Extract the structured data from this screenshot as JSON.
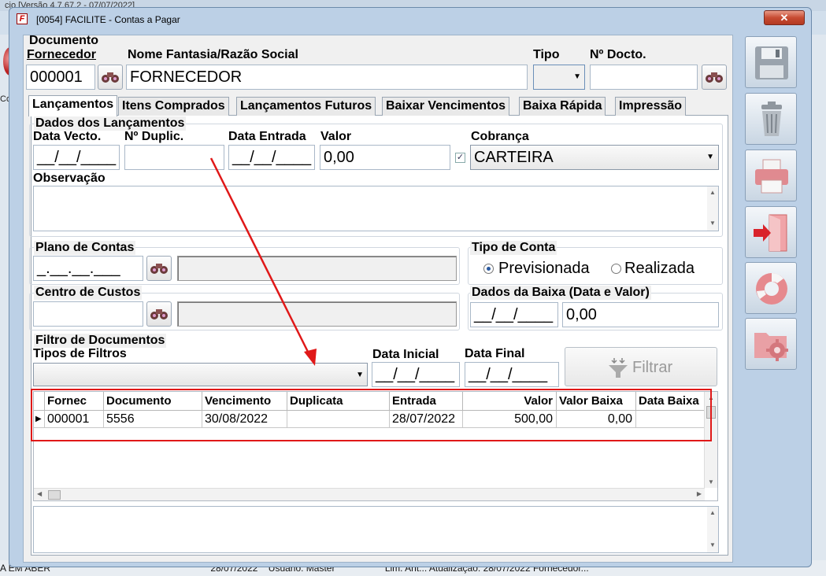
{
  "background_app": {
    "title": "cio [Versão 4.7.67.2 - 07/07/2022]",
    "side_text": "Co",
    "status_left": "A EM ABER",
    "status_texts": [
      "28/07/2022",
      "Usuário: Master",
      "Lim. Ant... Atualização: 28/07/2022 Fornecedor..."
    ]
  },
  "window": {
    "title": "[0054] FACILITE - Contas a Pagar",
    "close_label": "✕"
  },
  "header": {
    "documento_label": "Documento",
    "fornecedor_label": "Fornecedor",
    "fornecedor_value": "000001",
    "nome_label": "Nome Fantasia/Razão Social",
    "nome_value": "FORNECEDOR",
    "tipo_label": "Tipo",
    "tipo_value": "",
    "docto_label": "Nº Docto.",
    "docto_value": ""
  },
  "tabs": [
    {
      "label": "Lançamentos",
      "active": true
    },
    {
      "label": "Itens Comprados",
      "active": false
    },
    {
      "label": "Lançamentos Futuros",
      "active": false
    },
    {
      "label": "Baixar Vencimentos",
      "active": false
    },
    {
      "label": "Baixa Rápida",
      "active": false
    },
    {
      "label": "Impressão",
      "active": false
    }
  ],
  "lancamentos": {
    "group_title": "Dados dos Lançamentos",
    "data_vecto_label": "Data Vecto.",
    "data_vecto_value": "__/__/____",
    "duplic_label": "Nº Duplic.",
    "duplic_value": "",
    "data_entrada_label": "Data Entrada",
    "data_entrada_value": "__/__/____",
    "valor_label": "Valor",
    "valor_value": "0,00",
    "cobranca_label": "Cobrança",
    "cobranca_value": "CARTEIRA",
    "observacao_label": "Observação",
    "observacao_value": ""
  },
  "plano_contas": {
    "title": "Plano de Contas",
    "code_value": "_.__.__.___",
    "desc_value": ""
  },
  "tipo_conta": {
    "title": "Tipo de Conta",
    "options": [
      {
        "label": "Previsionada",
        "selected": true
      },
      {
        "label": "Realizada",
        "selected": false
      }
    ]
  },
  "centro_custos": {
    "title": "Centro de Custos",
    "code_value": "",
    "desc_value": ""
  },
  "dados_baixa": {
    "title": "Dados da Baixa (Data e Valor)",
    "date_value": "__/__/____",
    "valor_value": "0,00"
  },
  "filtro": {
    "title": "Filtro de Documentos",
    "tipos_label": "Tipos de Filtros",
    "tipos_value": "",
    "data_inicial_label": "Data Inicial",
    "data_inicial_value": "__/__/____",
    "data_final_label": "Data Final",
    "data_final_value": "__/__/____",
    "filtrar_label": "Filtrar"
  },
  "grid": {
    "columns": [
      "Fornec",
      "Documento",
      "Vencimento",
      "Duplicata",
      "Entrada",
      "Valor",
      "Valor Baixa",
      "Data Baixa"
    ],
    "rows": [
      [
        "000001",
        "5556",
        "30/08/2022",
        "",
        "28/07/2022",
        "500,00",
        "0,00",
        ""
      ]
    ]
  },
  "toolbar": {
    "icons": [
      "save-icon",
      "trash-icon",
      "printer-icon",
      "exit-door-icon",
      "lifebuoy-icon",
      "folder-gear-icon"
    ]
  },
  "colors": {
    "annotation_red": "#e01818",
    "window_frame": "#bcd0e6",
    "close_button": "#c74b32"
  }
}
